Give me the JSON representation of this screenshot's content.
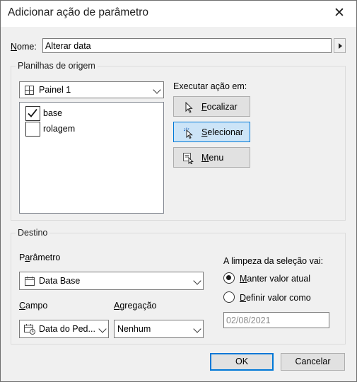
{
  "window": {
    "title": "Adicionar ação de parâmetro",
    "close_glyph": "✕"
  },
  "name": {
    "label": "Nome:",
    "value": "Alterar data"
  },
  "source": {
    "legend": "Planilhas de origem",
    "dashboard": "Painel 1",
    "sheets": [
      {
        "label": "base",
        "checked": true
      },
      {
        "label": "rolagem",
        "checked": false
      }
    ]
  },
  "run_on": {
    "label": "Executar ação em:",
    "options": [
      {
        "label": "Focalizar",
        "icon": "pointer-icon",
        "selected": false
      },
      {
        "label": "Selecionar",
        "icon": "select-cursor-icon",
        "selected": true
      },
      {
        "label": "Menu",
        "icon": "menu-icon",
        "selected": false
      }
    ]
  },
  "target": {
    "legend": "Destino",
    "parameter_label": "Parâmetro",
    "parameter_value": "Data Base",
    "field_label": "Campo",
    "field_value": "Data do Ped...",
    "aggregation_label": "Agregação",
    "aggregation_value": "Nenhum",
    "clear_label": "A limpeza da seleção vai:",
    "clear_options": [
      {
        "label": "Manter valor atual",
        "selected": true
      },
      {
        "label": "Definir valor como",
        "selected": false
      }
    ],
    "clear_value": "02/08/2021"
  },
  "buttons": {
    "ok": "OK",
    "cancel": "Cancelar"
  },
  "colors": {
    "accent": "#0078d7",
    "selected_bg": "#cce4f7",
    "dialog_bg": "#f0f0f0"
  }
}
